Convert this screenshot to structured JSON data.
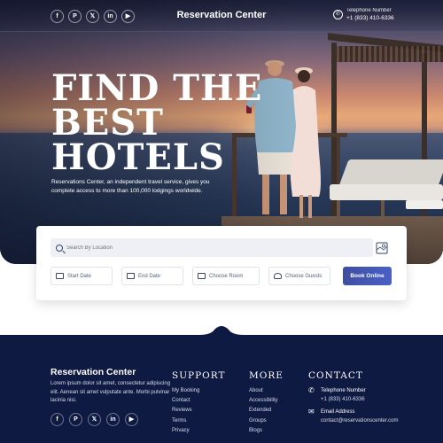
{
  "header": {
    "brand": "Reservation Center",
    "social_icons": [
      "facebook-icon",
      "pinterest-icon",
      "x-icon",
      "linkedin-icon",
      "youtube-icon"
    ],
    "social_glyphs": [
      "f",
      "P",
      "𝕏",
      "in",
      "▶"
    ],
    "phone_label": "Telephone Number",
    "phone_number": "+1 (833) 410-6336"
  },
  "hero": {
    "headline_lines": [
      "FIND THE",
      "BEST",
      "HOTELS"
    ],
    "description": "Reservations Center, an independent travel service, gives you complete access to more than 100,000 lodgings worldwide."
  },
  "search": {
    "placeholder": "Search By Location",
    "start_date": "Start Date",
    "end_date": "End Date",
    "room": "Choose Room",
    "guests": "Choose Guests",
    "book_label": "Book Online"
  },
  "footer": {
    "brand": "Reservation Center",
    "description": "Lorem ipsum dolor sit amet, consectetur adipiscing elit. Aenean sit amet vulputate ante. Morbi pulvinar lacinia nisi.",
    "support_title": "SUPPORT",
    "support_links": [
      "My Booking",
      "Contact",
      "Reviews",
      "Terms",
      "Privacy"
    ],
    "more_title": "MORE",
    "more_links": [
      "About",
      "Accessibility",
      "Extended",
      "Groups",
      "Blogs"
    ],
    "contact_title": "CONTACT",
    "phone_label": "Telephone Number",
    "phone_number": "+1 (833) 410-6336",
    "email_label": "Email Address",
    "email": "contact@reservationscenter.com"
  },
  "colors": {
    "footer_bg": "#0f1a42",
    "button": "#4356b3",
    "search_bg": "#eef0f5"
  }
}
